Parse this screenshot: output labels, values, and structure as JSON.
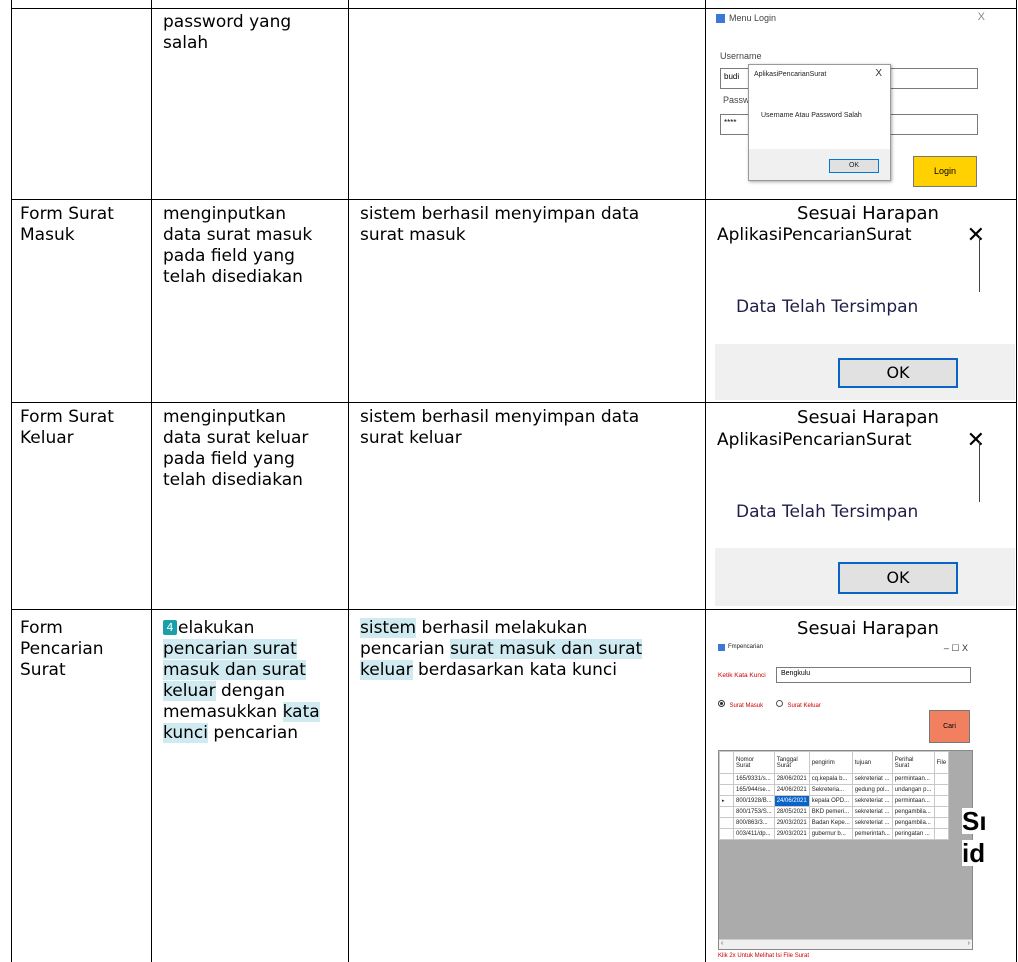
{
  "rows": [
    {
      "form": "",
      "action": "password yang\nsalah",
      "expected": "",
      "result": ""
    },
    {
      "form": "Form   Surat\nMasuk",
      "action": "menginputkan\ndata surat masuk\npada field yang\ntelah disediakan",
      "expected": "sistem berhasil menyimpan data\nsurat masuk",
      "result": "Sesuai Harapan"
    },
    {
      "form": "Form   Surat\nKeluar",
      "action": "menginputkan\ndata surat keluar\npada field yang\ntelah disediakan",
      "expected": "sistem berhasil menyimpan data\nsurat keluar",
      "result": "Sesuai Harapan"
    },
    {
      "form": "Form\nPencarian\nSurat",
      "action_badge": "4",
      "action_parts": [
        "elakukan",
        "pencarian surat",
        "masuk dan surat",
        "keluar",
        " dengan",
        "memasukkan ",
        "kata",
        "kunci",
        " pencarian"
      ],
      "expected_parts": [
        "sistem",
        " berhasil melakukan",
        "pencarian ",
        "surat masuk dan surat",
        "keluar",
        " berdasarkan kata kunci"
      ],
      "result": "Sesuai Harapan"
    }
  ],
  "login_dialog": {
    "window_title": "Menu Login",
    "username_label": "Username",
    "username_value": "budi",
    "password_label": "Passw",
    "password_value": "****",
    "login_button": "Login",
    "msg_title": "AplikasiPencarianSurat",
    "msg_text": "Username Atau Password Salah",
    "ok": "OK",
    "close": "X"
  },
  "save_box": {
    "title": "AplikasiPencarianSurat",
    "close": "✕",
    "message": "Data Telah Tersimpan",
    "ok": "OK"
  },
  "search_window": {
    "title": "Fmpencarian",
    "controls": "–   ☐   X",
    "keyword_label": "Ketik Kata Kunci",
    "keyword_value": "Bengkulu",
    "radio_masuk": "Surat Masuk",
    "radio_keluar": "Surat Keluar",
    "search_button": "Cari",
    "columns": [
      "Nomor\nSurat",
      "Tanggal\nSurat",
      "pengirim",
      "tujuan",
      "Perihal\nSurat",
      "File"
    ],
    "grid_rows": [
      [
        "165/9331/s...",
        "28/06/2021",
        "cq.kepala b...",
        "sekreteriat ...",
        "permintaan..."
      ],
      [
        "165/944/se...",
        "24/06/2021",
        "Sekreteria...",
        "gedung pol...",
        "undangan p..."
      ],
      [
        "800/1928/B...",
        "24/06/2021",
        "kepala OPD...",
        "sekreteriat ...",
        "permintaan..."
      ],
      [
        "800/1753/S...",
        "28/05/2021",
        "BKD pemeri...",
        "sekreteriat ...",
        "pengambila..."
      ],
      [
        "800/863/3...",
        "29/03/2021",
        "Badan Kepe...",
        "sekreteriat ...",
        "pengambila..."
      ],
      [
        "003/411/dp...",
        "29/03/2021",
        "gubernur b...",
        "pemerintah...",
        "peringatan ..."
      ]
    ],
    "overflow_text_1": "Sı",
    "overflow_text_2": "id",
    "hint": "Klik 2x Untuk Melihat Isi File Surat"
  }
}
